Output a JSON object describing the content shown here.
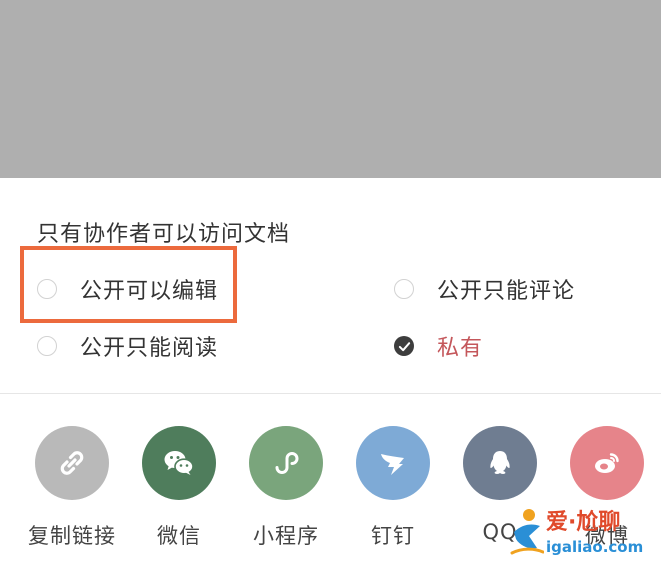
{
  "permissions": {
    "title": "只有协作者可以访问文档",
    "options": [
      {
        "label": "公开可以编辑",
        "checked": false
      },
      {
        "label": "公开只能评论",
        "checked": false
      },
      {
        "label": "公开只能阅读",
        "checked": false
      },
      {
        "label": "私有",
        "checked": true
      }
    ]
  },
  "share": {
    "items": [
      {
        "label": "复制链接",
        "icon": "link-icon",
        "color": "#b9b9b9"
      },
      {
        "label": "微信",
        "icon": "wechat-icon",
        "color": "#4f7d5c"
      },
      {
        "label": "小程序",
        "icon": "mini-program-icon",
        "color": "#7aa57c"
      },
      {
        "label": "钉钉",
        "icon": "dingtalk-icon",
        "color": "#7eaad6"
      },
      {
        "label": "QQ",
        "icon": "qq-icon",
        "color": "#6f7d91"
      },
      {
        "label": "微博",
        "icon": "weibo-icon",
        "color": "#e6848a"
      }
    ]
  },
  "watermark": {
    "text": "爱·尬聊",
    "url": "igaliao.com"
  },
  "colors": {
    "highlight": "#ec6a3d",
    "private_red": "#c4575b",
    "overlay": "#afafaf"
  }
}
